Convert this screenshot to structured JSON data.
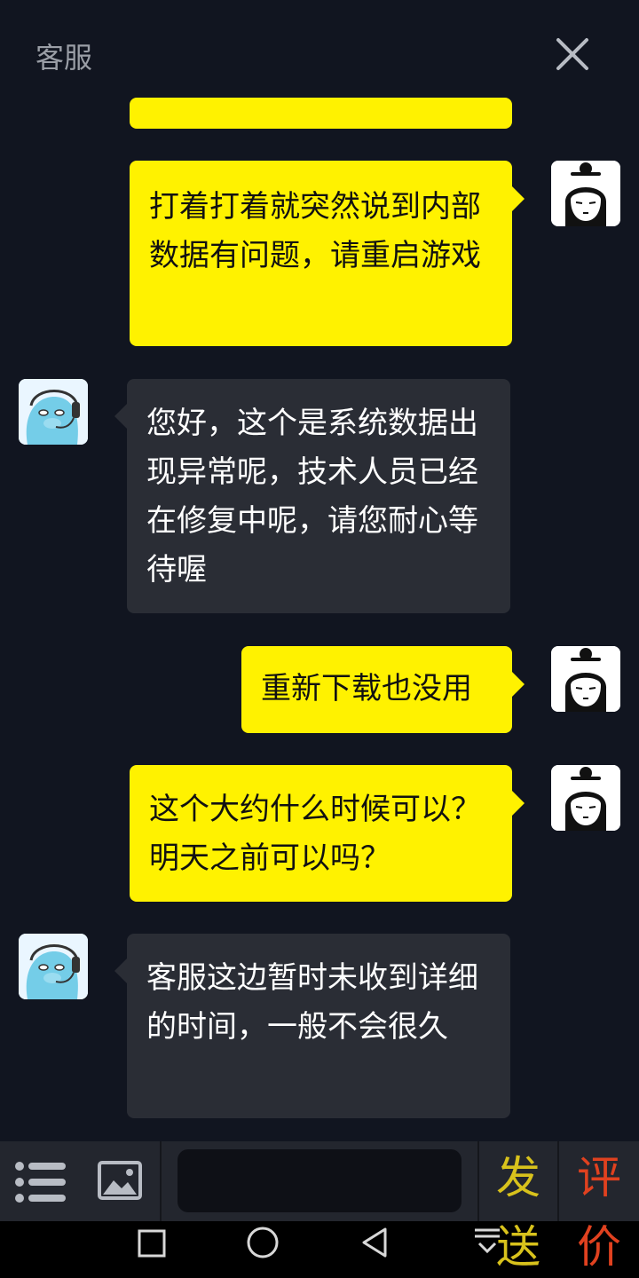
{
  "header": {
    "title": "客服"
  },
  "messages": [
    {
      "sender": "user",
      "text": "打着打着就突然说到内部数据有问题，请重启游戏"
    },
    {
      "sender": "agent",
      "text": "您好，这个是系统数据出现异常呢，技术人员已经在修复中呢，请您耐心等待喔"
    },
    {
      "sender": "user",
      "text": "重新下载也没用"
    },
    {
      "sender": "user",
      "text": "这个大约什么时候可以？明天之前可以吗？"
    },
    {
      "sender": "agent",
      "text": "客服这边暂时未收到详细的时间，一般不会很久"
    }
  ],
  "input": {
    "placeholder": ""
  },
  "send_button": {
    "top": "发",
    "bottom": "送"
  },
  "rate_button": {
    "top": "评",
    "bottom": "价"
  },
  "colors": {
    "background": "#111520",
    "user_bubble": "#fff200",
    "agent_bubble": "#2a2d35",
    "send_text": "#d8c21c",
    "rate_text": "#e0411f"
  },
  "icons": [
    "close-icon",
    "list-icon",
    "image-icon",
    "square-nav-icon",
    "circle-nav-icon",
    "back-nav-icon",
    "keyboard-down-icon"
  ]
}
